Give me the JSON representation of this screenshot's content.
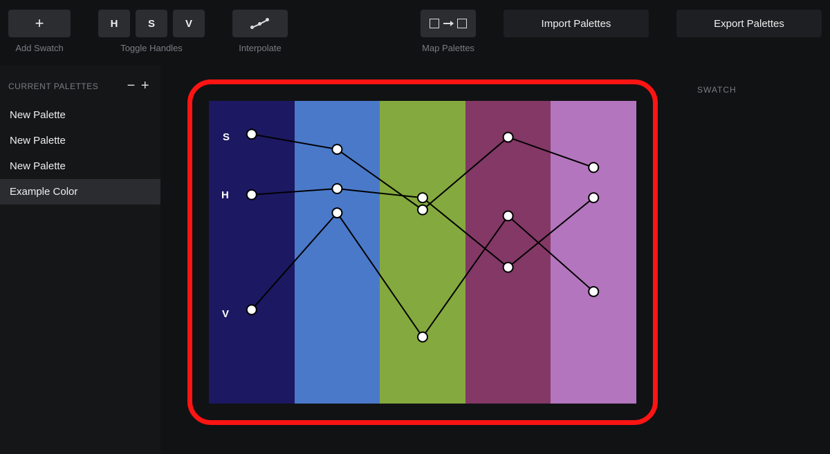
{
  "toolbar": {
    "add_swatch_label": "Add Swatch",
    "toggle_handles_label": "Toggle Handles",
    "h_label": "H",
    "s_label": "S",
    "v_label": "V",
    "interpolate_label": "Interpolate",
    "map_palettes_label": "Map Palettes",
    "import_label": "Import Palettes",
    "export_label": "Export Palettes"
  },
  "sidebar": {
    "title": "CURRENT PALETTES",
    "items": [
      {
        "label": "New Palette",
        "selected": false
      },
      {
        "label": "New Palette",
        "selected": false
      },
      {
        "label": "New Palette",
        "selected": false
      },
      {
        "label": "Example Color",
        "selected": true
      }
    ]
  },
  "right": {
    "swatch_label": "SWATCH"
  },
  "viewer": {
    "frame_color": "#ff1414",
    "axis_s": "S",
    "axis_h": "H",
    "axis_v": "V",
    "swatch_colors": [
      "#1c1861",
      "#4a79c9",
      "#84a93e",
      "#833866",
      "#b375bd"
    ],
    "curves": {
      "s": [
        0.11,
        0.16,
        0.36,
        0.12,
        0.22
      ],
      "h": [
        0.31,
        0.29,
        0.32,
        0.55,
        0.32
      ],
      "v": [
        0.69,
        0.37,
        0.78,
        0.38,
        0.63
      ]
    }
  }
}
